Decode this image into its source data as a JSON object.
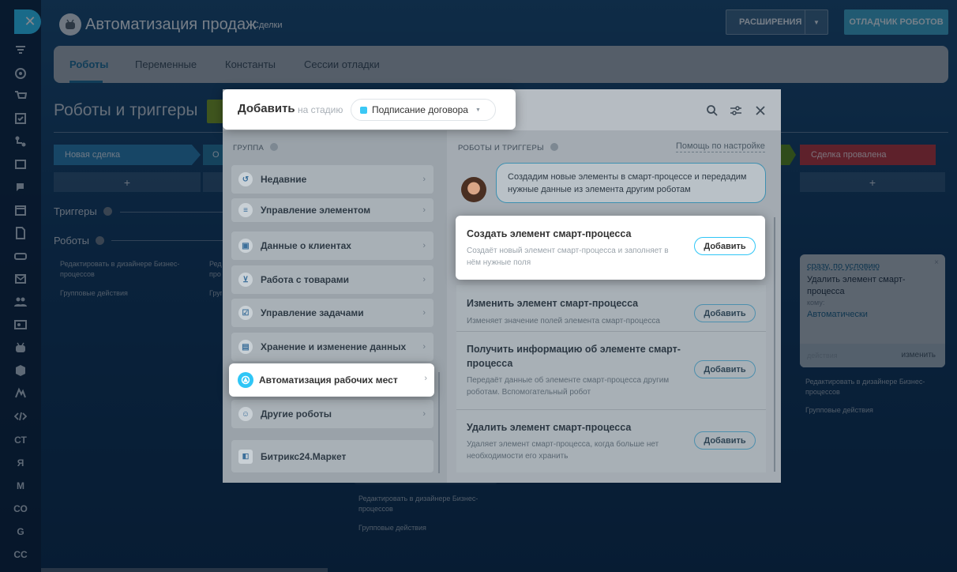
{
  "header": {
    "app_title": "Автоматизация продаж",
    "app_subtitle": "Сделки",
    "extensions_label": "РАСШИРЕНИЯ",
    "debug_label": "ОТЛАДЧИК РОБОТОВ"
  },
  "left_bar": {
    "close": "✕",
    "items": [
      "СТ",
      "Я",
      "М",
      "СО",
      "G",
      "СС"
    ]
  },
  "tabs": [
    {
      "label": "Роботы"
    },
    {
      "label": "Переменные"
    },
    {
      "label": "Константы"
    },
    {
      "label": "Сессии отладки"
    }
  ],
  "page": {
    "title": "Роботы и триггеры",
    "stage_new": "Новая сделка",
    "stage_o": "О",
    "stage_fail": "Сделка провалена",
    "plus": "+",
    "triggers_label": "Триггеры",
    "robots_label": "Роботы",
    "edit_designer": "Редактировать в дизайнере Бизнес-процессов",
    "edit_designer_short": "Ред про",
    "group_actions": "Групповые действия",
    "group_actions_short": "Груп"
  },
  "robot_card": {
    "condition": "сразу, по условию",
    "name": "Удалить элемент смарт-процесса",
    "to_label": "кому:",
    "to_value": "Автоматически",
    "actions": "действия",
    "edit": "изменить",
    "close": "×"
  },
  "dialog": {
    "add_label": "Добавить",
    "stage_prefix": "на стадию",
    "stage_value": "Подписание договора",
    "group_header": "ГРУППА",
    "groups": [
      {
        "label": "Недавние",
        "icon": "history-icon"
      },
      {
        "label": "Управление элементом",
        "icon": "filter-icon"
      },
      {
        "label": "Данные о клиентах",
        "icon": "contact-card-icon"
      },
      {
        "label": "Работа с товарами",
        "icon": "cart-icon"
      },
      {
        "label": "Управление задачами",
        "icon": "task-icon"
      },
      {
        "label": "Хранение и изменение данных",
        "icon": "database-icon"
      },
      {
        "label": "Автоматизация рабочих мест",
        "icon": "workplace-icon"
      },
      {
        "label": "Другие роботы",
        "icon": "robot-icon"
      }
    ],
    "market_label": "Битрикс24.Маркет",
    "robots_header": "РОБОТЫ И ТРИГГЕРЫ",
    "help_link": "Помощь по настройке",
    "bubble_text": "Создадим новые элементы в смарт-процессе и передадим нужные данные из элемента другим роботам",
    "add_button": "Добавить",
    "robots": [
      {
        "title": "Создать элемент смарт-процесса",
        "desc": "Создаёт новый элемент смарт-процесса и заполняет в нём нужные поля"
      },
      {
        "title": "Изменить элемент смарт-процесса",
        "desc": "Изменяет значение полей элемента смарт-процесса"
      },
      {
        "title": "Получить информацию об элементе смарт-процесса",
        "desc": "Передаёт данные об элементе смарт-процесса другим роботам. Вспомогательный робот"
      },
      {
        "title": "Удалить элемент смарт-процесса",
        "desc": "Удаляет элемент смарт-процесса, когда больше нет необходимости его хранить"
      }
    ]
  },
  "colors": {
    "accent": "#2fc6f6",
    "fail_stage": "#b8343b",
    "debug_button": "#3ea6c9"
  }
}
